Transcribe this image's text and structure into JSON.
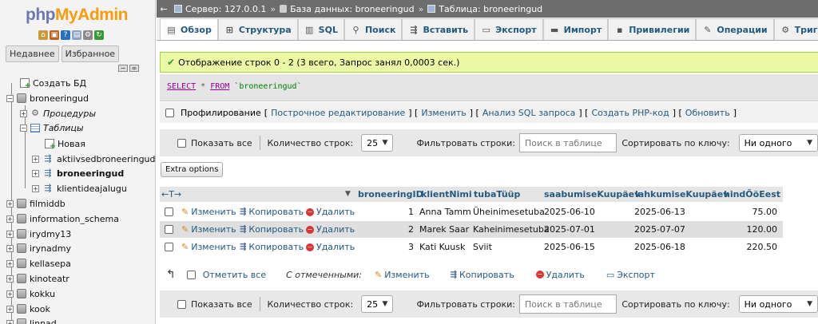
{
  "nav": {
    "logo_php": "php",
    "logo_myadmin": "MyAdmin",
    "tabs": [
      "Недавнее",
      "Избранное"
    ],
    "create_db": "Создать БД",
    "current_db": "broneeringud",
    "procedures": "Процедуры",
    "tables": "Таблицы",
    "new_table": "Новая",
    "table_list": [
      "aktiivsedbroneeringud",
      "broneeringud",
      "klientideajalugu"
    ],
    "databases": [
      "filmiddb",
      "information_schema",
      "irydmy13",
      "irynadmy",
      "kellasepa",
      "kinoteatr",
      "kokku",
      "kook",
      "linnad"
    ]
  },
  "topbar": {
    "server": "Сервер: 127.0.0.1",
    "database": "База данных: broneeringud",
    "table": "Таблица: broneeringud"
  },
  "menu": {
    "tabs": [
      {
        "label": "Обзор",
        "icon": "browse-icon",
        "glyph": "▤"
      },
      {
        "label": "Структура",
        "icon": "structure-icon",
        "glyph": "⊞"
      },
      {
        "label": "SQL",
        "icon": "sql-icon",
        "glyph": "▥"
      },
      {
        "label": "Поиск",
        "icon": "search-icon",
        "glyph": "⚲"
      },
      {
        "label": "Вставить",
        "icon": "insert-icon",
        "glyph": "⇶"
      },
      {
        "label": "Экспорт",
        "icon": "export-icon",
        "glyph": "▭"
      },
      {
        "label": "Импорт",
        "icon": "import-icon",
        "glyph": "▬"
      },
      {
        "label": "Привилегии",
        "icon": "privileges-icon",
        "glyph": "▪"
      },
      {
        "label": "Операции",
        "icon": "operations-icon",
        "glyph": "✎"
      },
      {
        "label": "Триггеры",
        "icon": "triggers-icon",
        "glyph": "⚙"
      }
    ]
  },
  "message": "Отображение строк 0 - 2 (3 всего, Запрос занял 0,0003 сек.)",
  "sql": {
    "select": "SELECT",
    "star": " * ",
    "from": "FROM",
    "table": " `broneeringud`"
  },
  "links": {
    "profiling": "Профилирование",
    "inline_edit": "Построчное редактирование",
    "edit": "Изменить",
    "analyze": "Анализ SQL запроса",
    "php": "Создать PHP-код",
    "refresh": "Обновить"
  },
  "filter": {
    "show_all": "Показать все",
    "rows_label": "Количество строк:",
    "rows_value": "25",
    "filter_label": "Фильтровать строки:",
    "filter_placeholder": "Поиск в таблице",
    "sort_label": "Сортировать по ключу:",
    "sort_value": "Ни одного"
  },
  "extra_options": "Extra options",
  "table": {
    "columns": [
      "broneeringID",
      "klientNimi",
      "tubaTüüp",
      "saabumiseKuupäev",
      "lahkumiseKuupäev",
      "hindÖöEest"
    ],
    "rows": [
      [
        "1",
        "Anna Tamm",
        "Üheinimesetuba",
        "2025-06-10",
        "2025-06-13",
        "75.00"
      ],
      [
        "2",
        "Marek Saar",
        "Kaheinimesetuba",
        "2025-07-01",
        "2025-07-07",
        "120.00"
      ],
      [
        "3",
        "Kati Kuusk",
        "Sviit",
        "2025-06-15",
        "2025-06-18",
        "220.50"
      ]
    ],
    "actions": {
      "edit": "Изменить",
      "copy": "Копировать",
      "delete": "Удалить"
    }
  },
  "bulk": {
    "check_all": "Отметить все",
    "with_selected": "С отмеченными:",
    "edit": "Изменить",
    "copy": "Копировать",
    "delete": "Удалить",
    "export": "Экспорт"
  },
  "colors": {
    "link": "#235a81",
    "success_bg": "#ebf8a4",
    "topbar": "#6d6d6d"
  }
}
